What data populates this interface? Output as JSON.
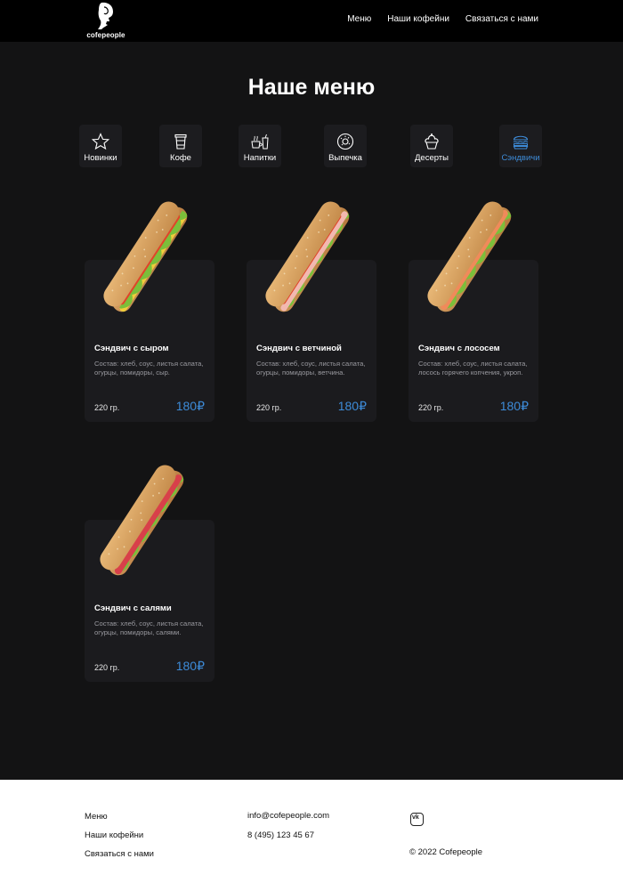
{
  "header": {
    "logo_text": "cofepeople",
    "nav": [
      "Меню",
      "Наши кофейни",
      "Связаться с нами"
    ]
  },
  "title": "Наше меню",
  "categories": [
    {
      "label": "Новинки",
      "icon": "star-icon",
      "active": false
    },
    {
      "label": "Кофе",
      "icon": "coffee-cup-icon",
      "active": false
    },
    {
      "label": "Напитки",
      "icon": "drinks-icon",
      "active": false
    },
    {
      "label": "Выпечка",
      "icon": "donut-icon",
      "active": false
    },
    {
      "label": "Десерты",
      "icon": "cupcake-icon",
      "active": false
    },
    {
      "label": "Сэндвичи",
      "icon": "burger-icon",
      "active": true
    }
  ],
  "products": [
    {
      "name": "Сэндвич с сыром",
      "description": "Состав: хлеб, соус, листья салата, огурцы, помидоры, сыр.",
      "weight": "220 гр.",
      "price": "180₽"
    },
    {
      "name": "Сэндвич с ветчиной",
      "description": "Состав: хлеб, соус, листья салата, огурцы, помидоры, ветчина.",
      "weight": "220 гр.",
      "price": "180₽"
    },
    {
      "name": "Сэндвич с лососем",
      "description": "Состав: хлеб, соус, листья салата, лосось горячего копчения, укроп.",
      "weight": "220 гр.",
      "price": "180₽"
    },
    {
      "name": "Сэндвич с салями",
      "description": "Состав: хлеб, соус, листья салата, огурцы, помидоры, салями.",
      "weight": "220 гр.",
      "price": "180₽"
    }
  ],
  "footer": {
    "links": [
      "Меню",
      "Наши кофейни",
      "Связаться с нами"
    ],
    "email": "info@cofepeople.com",
    "phone": "8 (495) 123 45 67",
    "social_label": "vk",
    "social_icon": "vk-icon",
    "copyright": "© 2022 Cofepeople"
  },
  "colors": {
    "accent": "#3d8bd8",
    "background": "#131314",
    "card": "#1b1b1e",
    "header": "#000000",
    "footer": "#ffffff"
  }
}
